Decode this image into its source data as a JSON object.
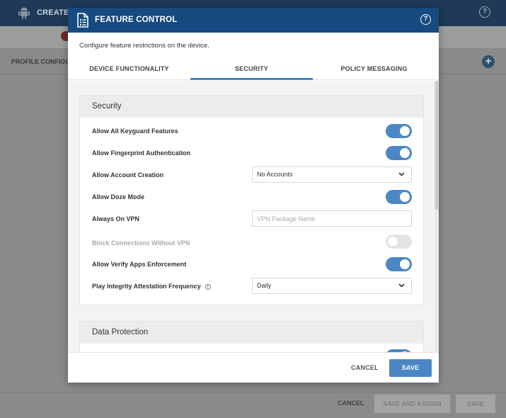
{
  "background": {
    "header_title": "CREATE F",
    "help_glyph": "?",
    "profile_config_label": "PROFILE CONFIGU",
    "plus_glyph": "+",
    "cancel_label": "CANCEL",
    "save_and_assign_label": "SAVE AND ASSIGN",
    "save_label": "SAVE"
  },
  "modal": {
    "title": "FEATURE CONTROL",
    "help_glyph": "?",
    "description": "Configure feature restrictions on the device.",
    "tabs": [
      {
        "label": "DEVICE FUNCTIONALITY",
        "active": false
      },
      {
        "label": "SECURITY",
        "active": true
      },
      {
        "label": "POLICY MESSAGING",
        "active": false
      }
    ],
    "sections": {
      "security": {
        "title": "Security",
        "rows": [
          {
            "label": "Allow All Keyguard Features",
            "control": "toggle",
            "state": "on"
          },
          {
            "label": "Allow Fingerprint Authentication",
            "control": "toggle",
            "state": "on"
          },
          {
            "label": "Allow Account Creation",
            "control": "select",
            "value": "No Accounts"
          },
          {
            "label": "Allow Doze Mode",
            "control": "toggle",
            "state": "on"
          },
          {
            "label": "Always On VPN",
            "control": "text",
            "value": "",
            "placeholder": "VPN Package Name"
          },
          {
            "label": "Block Connections Without VPN",
            "control": "toggle",
            "state": "off",
            "disabled": true
          },
          {
            "label": "Allow Verify Apps Enforcement",
            "control": "toggle",
            "state": "on"
          },
          {
            "label": "Play Integrity Attestation Frequency",
            "control": "select",
            "value": "Daily",
            "info_icon": "info-icon"
          }
        ]
      },
      "data_protection": {
        "title": "Data Protection"
      }
    },
    "footer": {
      "cancel_label": "CANCEL",
      "save_label": "SAVE"
    }
  },
  "colors": {
    "header_blue": "#164a80",
    "accent_blue": "#4b87c4",
    "toggle_off": "#e4e4e4"
  },
  "icons": {
    "app": "android-icon",
    "modal": "document-list-icon",
    "help": "help-circle-icon",
    "select": "chevron-down-icon",
    "info": "info-icon",
    "add": "plus-circle-icon"
  }
}
